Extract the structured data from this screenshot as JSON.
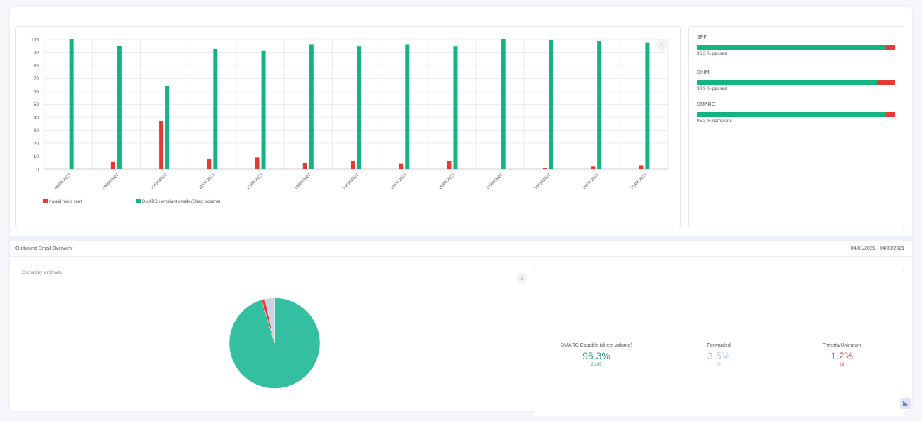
{
  "top_section": {
    "title": "",
    "date_range": ""
  },
  "chart_data": [
    {
      "type": "bar",
      "categories": [
        "08/04/2021",
        "09/04/2021",
        "10/04/2021",
        "11/04/2021",
        "12/04/2021",
        "13/04/2021",
        "14/04/2021",
        "15/04/2021",
        "16/04/2021",
        "17/04/2021",
        "18/04/2021",
        "19/04/2021",
        "20/04/2021"
      ],
      "series": [
        {
          "name": "Invalid mails sent",
          "color": "#e53935",
          "values": [
            0,
            5.5,
            37,
            8,
            9,
            4.5,
            6,
            4,
            6,
            0,
            1,
            2,
            3
          ]
        },
        {
          "name": "DMARC compliant emails (Direct Volume)",
          "color": "#14b482",
          "values": [
            100,
            95,
            64,
            92.5,
            91.5,
            96,
            94.5,
            96,
            94.5,
            100,
            99.5,
            98.5,
            97.5
          ]
        }
      ],
      "ylim": [
        0,
        100
      ],
      "yticks": [
        0,
        10,
        20,
        30,
        40,
        50,
        60,
        70,
        80,
        90,
        100
      ],
      "grid": true,
      "legend_position": "bottom-left"
    },
    {
      "type": "pie",
      "slices": [
        {
          "label": "DMARC Capable (direct volume)",
          "value": 95.3,
          "color": "#33bfa0"
        },
        {
          "label": "Threats/Unknown",
          "value": 1.2,
          "color": "#e53935"
        },
        {
          "label": "Forwarded",
          "value": 3.5,
          "color": "#c9d2e6"
        }
      ]
    }
  ],
  "auth": {
    "items": [
      {
        "label": "SPF",
        "percent": 95.3,
        "text": "95.3 % passed"
      },
      {
        "label": "DKIM",
        "percent": 90.9,
        "text": "90.9 % passed"
      },
      {
        "label": "DMARC",
        "percent": 95.3,
        "text": "95.3 % compliant"
      }
    ]
  },
  "outbound": {
    "title": "Outbound Email Overview",
    "date_range": "04/01/2021 - 04/30/2021",
    "credit": "JS chart by amCharts",
    "stats": [
      {
        "name": "DMARC Capable (direct volume)",
        "pct": "95.3%",
        "count": "2,245",
        "color": "#33a87e",
        "count_color": "#33a87e"
      },
      {
        "name": "Forwarded",
        "pct": "3.5%",
        "count": "82",
        "color": "#b8c3db",
        "count_color": "#b8c3db"
      },
      {
        "name": "Threats/Unknown",
        "pct": "1.2%",
        "count": "28",
        "color": "#e53935",
        "count_color": "#e53935"
      }
    ]
  },
  "icons": {
    "download": "download-icon",
    "scroll": "scroll-top-icon"
  }
}
